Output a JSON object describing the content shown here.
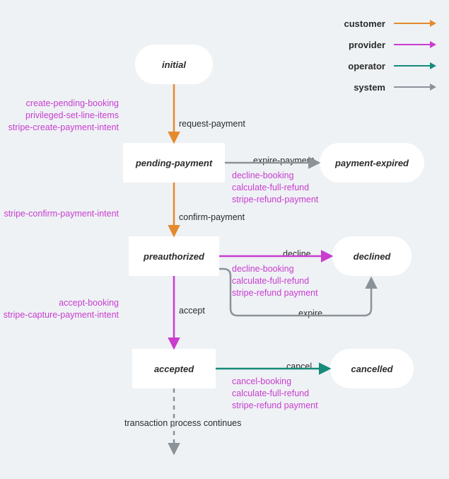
{
  "legend": {
    "customer": "customer",
    "provider": "provider",
    "operator": "operator",
    "system": "system"
  },
  "nodes": {
    "initial": "initial",
    "pending_payment": "pending-payment",
    "preauthorized": "preauthorized",
    "accepted": "accepted",
    "payment_expired": "payment-expired",
    "declined": "declined",
    "cancelled": "cancelled"
  },
  "transitions": {
    "request_payment": "request-payment",
    "confirm_payment": "confirm-payment",
    "accept": "accept",
    "expire_payment": "expire-payment",
    "decline": "decline",
    "expire": "expire",
    "cancel": "cancel",
    "continues": "transaction process continues"
  },
  "actions": {
    "request_payment": [
      "create-pending-booking",
      "privileged-set-line-items",
      "stripe-create-payment-intent"
    ],
    "confirm_payment": [
      "stripe-confirm-payment-intent"
    ],
    "accept": [
      "accept-booking",
      "stripe-capture-payment-intent"
    ],
    "expire_payment": [
      "decline-booking",
      "calculate-full-refund",
      "stripe-refund-payment"
    ],
    "decline": [
      "decline-booking",
      "calculate-full-refund",
      "stripe-refund payment"
    ],
    "cancel": [
      "cancel-booking",
      "calculate-full-refund",
      "stripe-refund payment"
    ]
  },
  "colors": {
    "customer": "#e58a2e",
    "provider": "#c93ccf",
    "operator": "#178a7a",
    "system": "#8b9298"
  }
}
